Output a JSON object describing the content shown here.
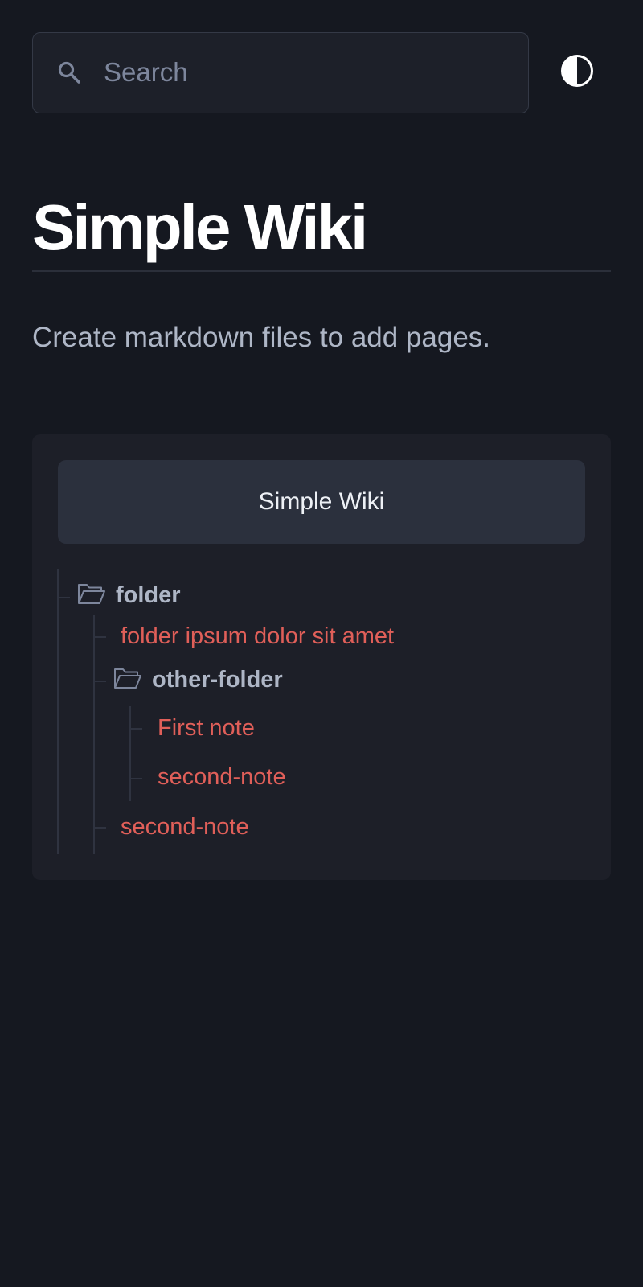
{
  "search": {
    "placeholder": "Search",
    "value": ""
  },
  "theme_toggle": {
    "icon": "half-circle-contrast-icon"
  },
  "page": {
    "title": "Simple Wiki",
    "intro": "Create markdown files to add pages."
  },
  "tree": {
    "header": "Simple Wiki",
    "folder": {
      "label": "folder",
      "icon": "folder-open-icon",
      "note": "folder ipsum dolor sit amet",
      "subfolder": {
        "label": "other-folder",
        "icon": "folder-open-icon",
        "notes": [
          "First note",
          "second-note"
        ]
      },
      "last_note": "second-note"
    }
  },
  "colors": {
    "background": "#151820",
    "panel": "#1d1f28",
    "panel_header": "#2b303d",
    "link": "#e05f59",
    "muted_text": "#aeb6c6"
  }
}
